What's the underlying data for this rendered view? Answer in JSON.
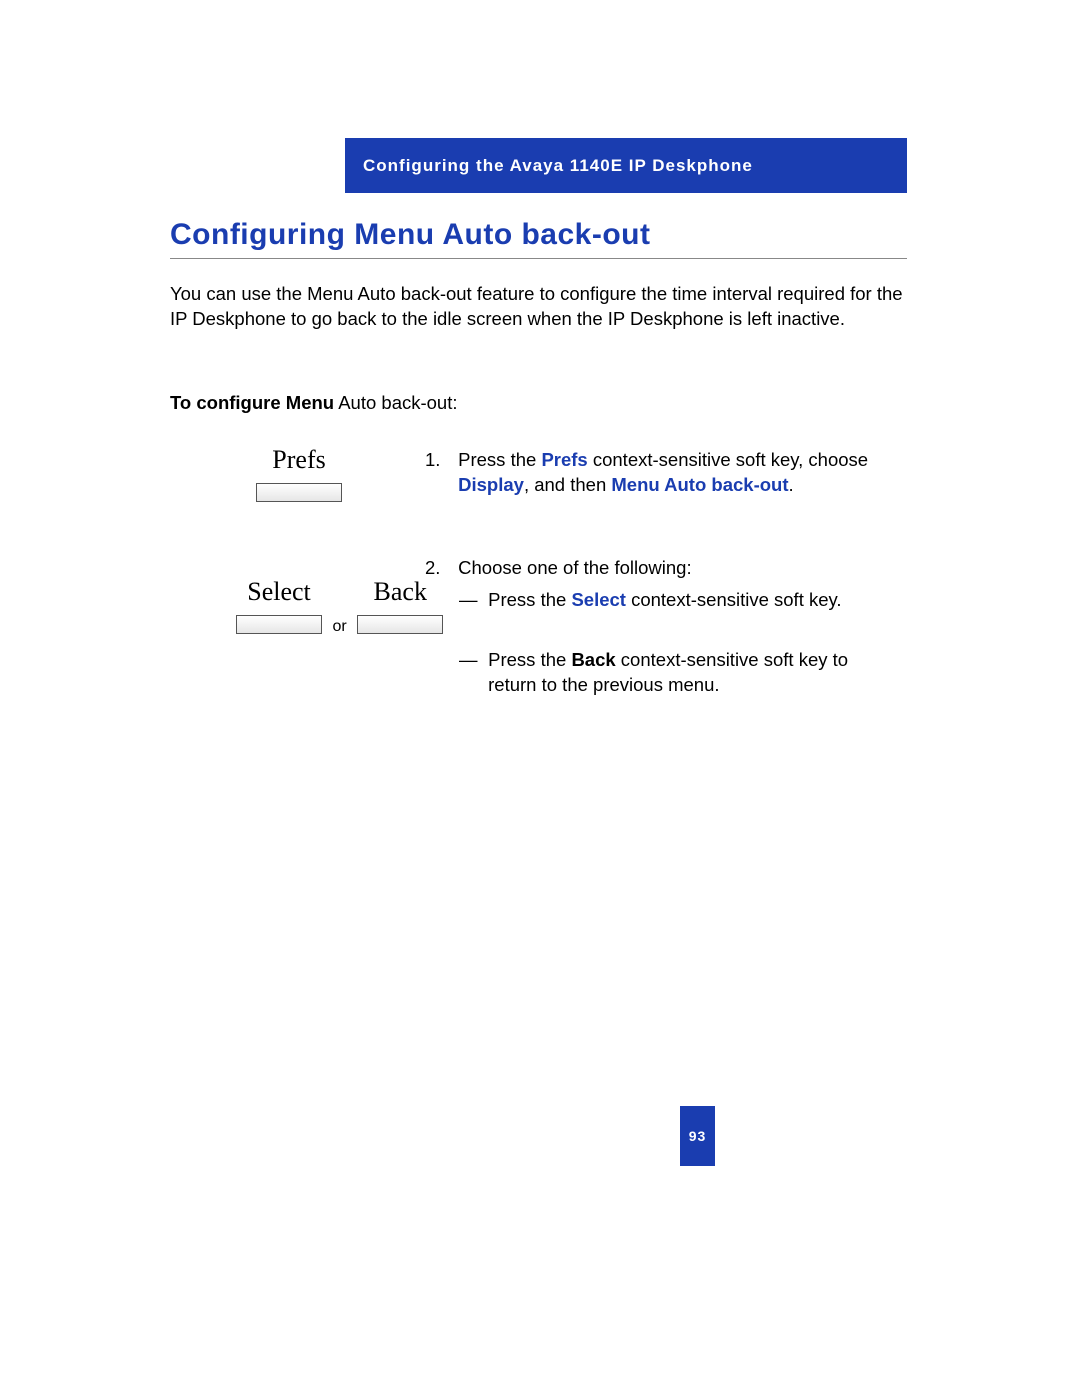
{
  "header": {
    "chapter": "Configuring the Avaya 1140E IP Deskphone"
  },
  "title": "Configuring Menu Auto back-out",
  "intro": "You can use the Menu Auto back-out feature to configure the time interval required for the IP Deskphone to go back to the idle screen when the IP Deskphone is left inactive.",
  "config_label_bold": "To configure Menu",
  "config_label_rest": " Auto back-out:",
  "softkeys": {
    "prefs": "Prefs",
    "select": "Select",
    "back": "Back",
    "or": "or"
  },
  "steps": {
    "s1_num": "1.",
    "s1_a": "Press the ",
    "s1_prefs": "Prefs",
    "s1_b": " context-sensitive soft key, choose ",
    "s1_display": "Display",
    "s1_c": ", and then ",
    "s1_menu": "Menu Auto back-out",
    "s1_d": ".",
    "s2_num": "2.",
    "s2_intro": "Choose one of the following:",
    "dash": "—",
    "s2a_a": "Press the ",
    "s2a_select": "Select",
    "s2a_b": " context-sensitive soft key.",
    "s2b_a": "Press the ",
    "s2b_back": "Back",
    "s2b_b": " context-sensitive soft key to return to the previous menu."
  },
  "page_number": "93"
}
